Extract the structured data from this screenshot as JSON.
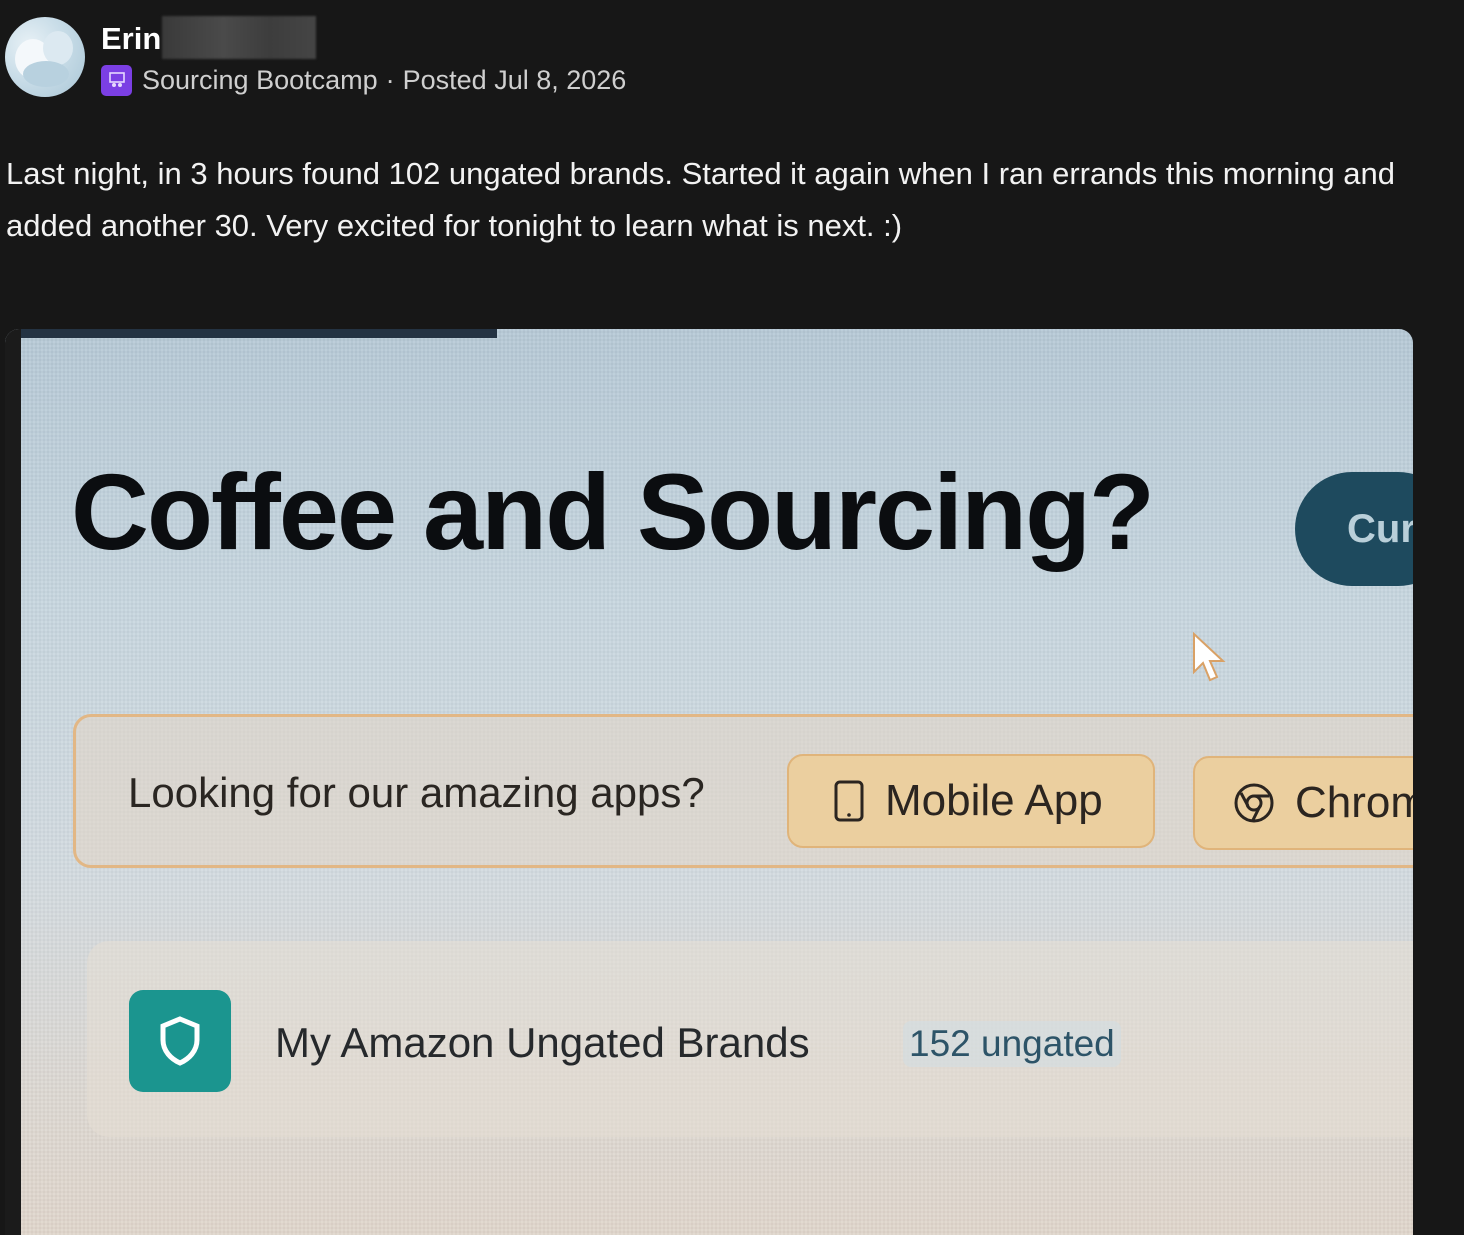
{
  "post": {
    "author_name": "Erin",
    "space_name": "Sourcing Bootcamp",
    "separator": "·",
    "posted_label": "Posted Jul 8, 2026",
    "body": "Last night, in 3 hours found 102 ungated brands. Started it again when I ran errands this morning and added another 30. Very excited for tonight to learn what is next. :)",
    "space_icon_color": "#7b3fe4"
  },
  "photo": {
    "title": "Coffee and Sourcing?",
    "cta_partial": "Cur",
    "apps_prompt": "Looking for our amazing apps?",
    "mobile_app_label": "Mobile App",
    "chrome_partial": "Chrom",
    "brands_label": "My Amazon Ungated Brands",
    "brands_count": "152 ungated",
    "accent_teal": "#1b958f",
    "cta_color": "#1e4a5e"
  },
  "icons": {
    "space": "people-presentation-icon",
    "mobile": "phone-icon",
    "chrome": "chrome-icon",
    "shield": "shield-icon",
    "cursor": "mouse-cursor-icon"
  }
}
